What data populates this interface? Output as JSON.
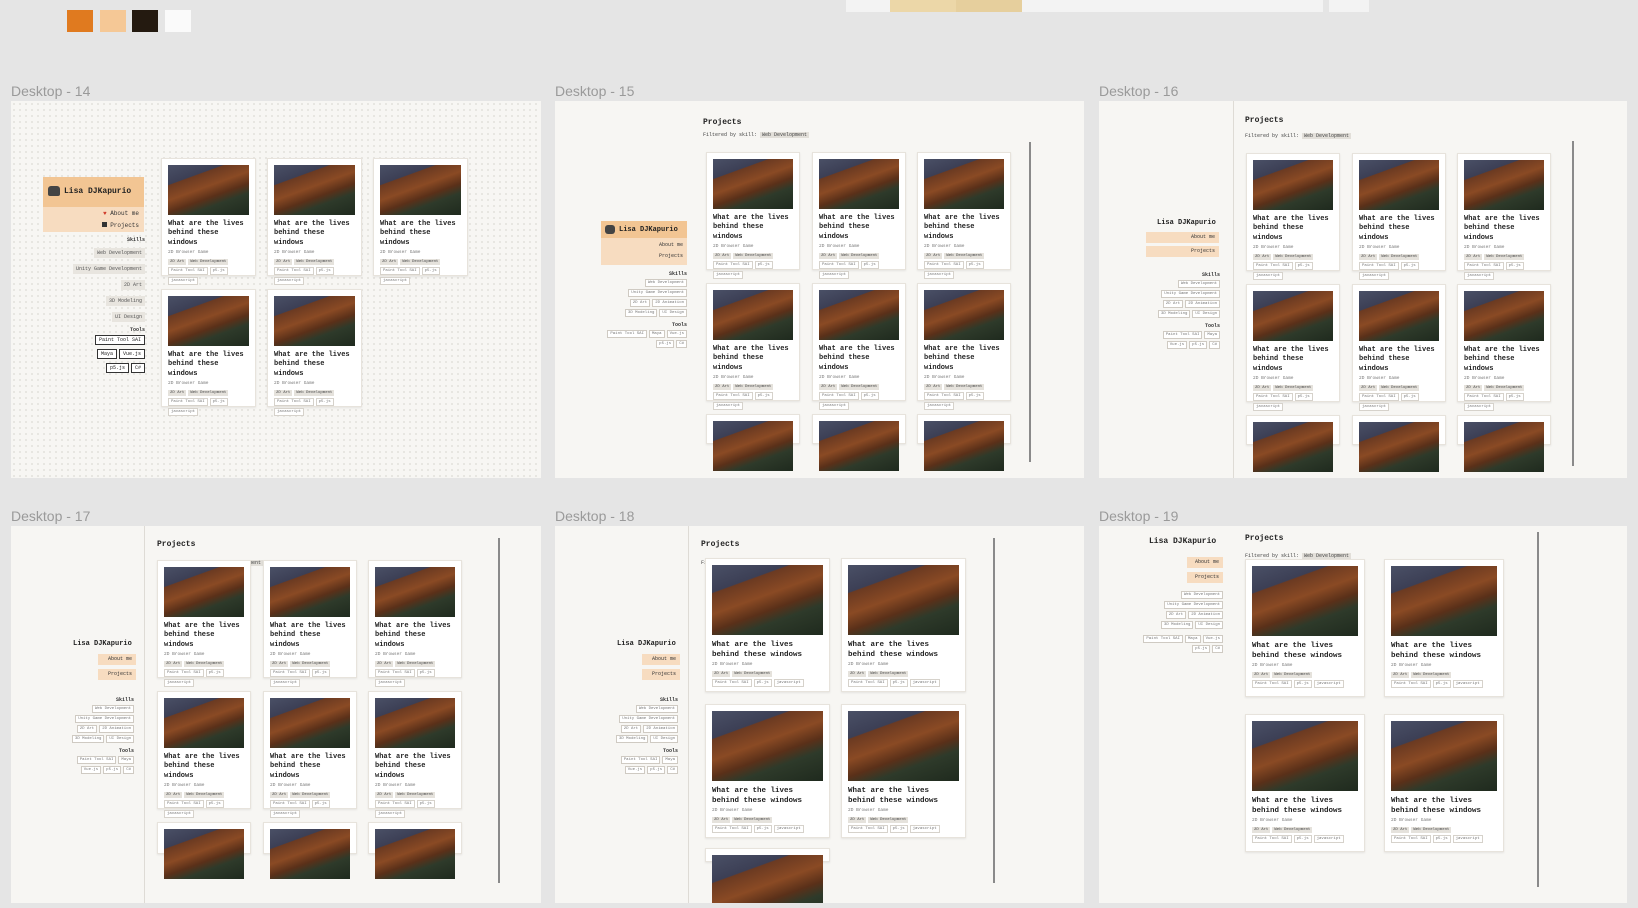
{
  "swatches": [
    "#e07a1f",
    "#f5c896",
    "#241a10",
    "#fafafa"
  ],
  "project": {
    "title": "What are the lives behind these windows",
    "subtitle": "2D Browser Game",
    "skill_tags": [
      "2D Art",
      "Web Development"
    ],
    "tool_tags": [
      "Paint Tool SAI",
      "p5.js",
      "javascript"
    ]
  },
  "user_name": "Lisa DJKapurio",
  "nav": {
    "about": "About me",
    "projects": "Projects"
  },
  "skills_label": "Skills",
  "tools_label": "Tools",
  "skills": [
    "Web Development",
    "Unity Game Development",
    "2D Art",
    "3D Modeling",
    "UI Design"
  ],
  "skills_b": [
    "Web Development",
    "Unity Game Development",
    "2D Art",
    "2D Animation",
    "3D Modeling",
    "UI Design"
  ],
  "tools": [
    "Paint Tool SAI",
    "Maya",
    "Vue.js",
    "p5.js",
    "C#"
  ],
  "projects_title": "Projects",
  "filter_label": "Filtered by skill:",
  "filter_value": "Web Development",
  "frames": {
    "d14": "Desktop - 14",
    "d15": "Desktop - 15",
    "d16": "Desktop - 16",
    "d17": "Desktop - 17",
    "d18": "Desktop - 18",
    "d19": "Desktop - 19"
  }
}
